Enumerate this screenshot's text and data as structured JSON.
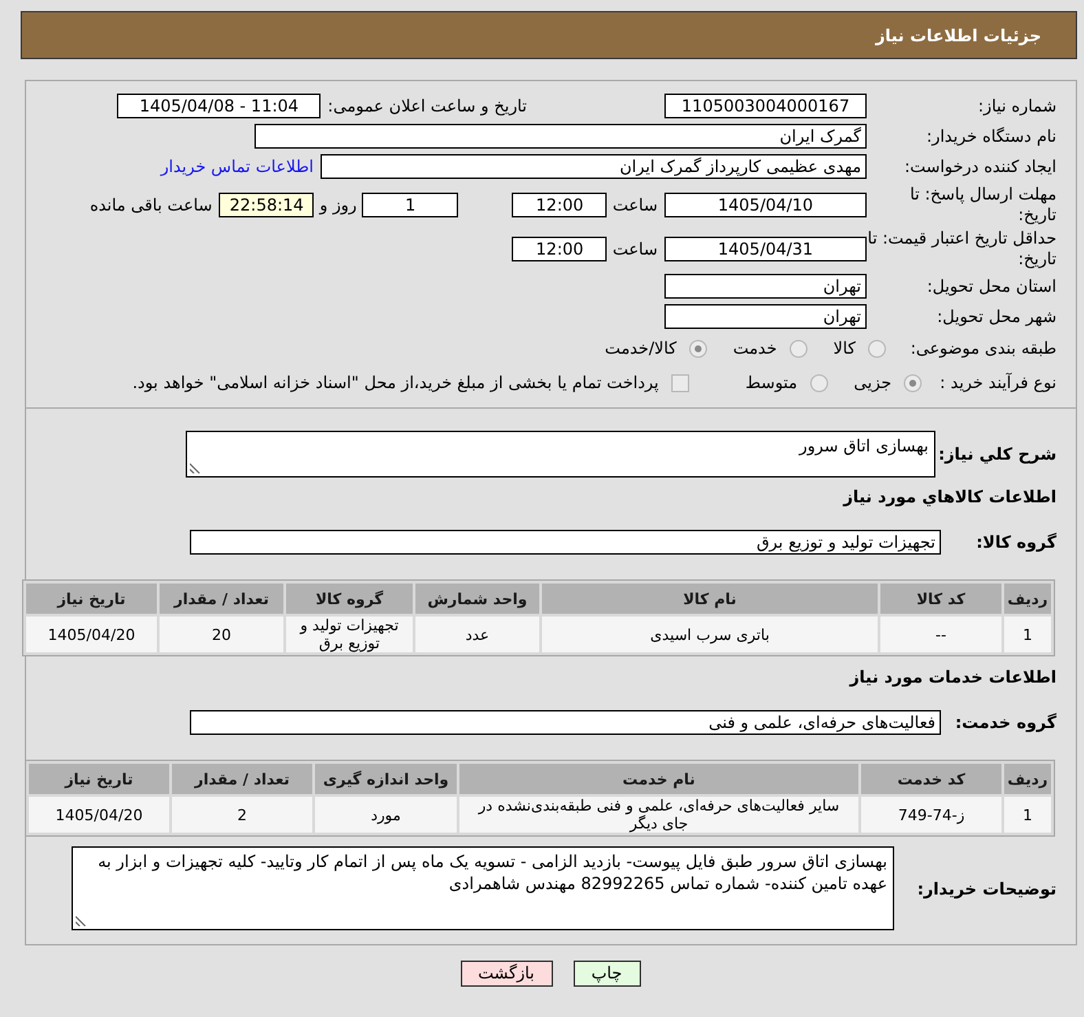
{
  "header": {
    "title": "جزئیات اطلاعات نیاز"
  },
  "need_info": {
    "need_number": {
      "label": "شماره نیاز:",
      "value": "1105003004000167"
    },
    "announcement": {
      "label": "تاریخ و ساعت اعلان عمومی:",
      "value": "1405/04/08 - 11:04"
    },
    "buyer_organization": {
      "label": "نام دستگاه خریدار:",
      "value": "گمرک ایران"
    },
    "requester": {
      "label": "ایجاد کننده درخواست:",
      "value": "مهدی عظیمی کارپرداز گمرک ایران",
      "contact_link": "اطلاعات تماس خریدار"
    },
    "response_deadline": {
      "label": "مهلت ارسال پاسخ: تا تاریخ:",
      "date": "1405/04/10",
      "time_label": "ساعت",
      "time": "12:00",
      "days": "1",
      "days_label": "روز و",
      "remaining_time": "22:58:14",
      "remaining_label": "ساعت باقی مانده"
    },
    "price_validity": {
      "label": "حداقل تاریخ اعتبار قیمت: تا تاریخ:",
      "date": "1405/04/31",
      "time_label": "ساعت",
      "time": "12:00"
    },
    "delivery_province": {
      "label": "استان محل تحویل:",
      "value": "تهران"
    },
    "delivery_city": {
      "label": "شهر محل تحویل:",
      "value": "تهران"
    },
    "subject_category": {
      "label": "طبقه بندی موضوعی:",
      "options": [
        {
          "label": "کالا",
          "selected": false
        },
        {
          "label": "خدمت",
          "selected": false
        },
        {
          "label": "کالا/خدمت",
          "selected": true
        }
      ]
    },
    "purchase_process": {
      "label": "نوع فرآیند خرید :",
      "options": [
        {
          "label": "جزیی",
          "selected": true
        },
        {
          "label": "متوسط",
          "selected": false
        }
      ],
      "treasury_payment": {
        "label": "پرداخت تمام یا بخشی از مبلغ خرید،از محل \"اسناد خزانه اسلامی\" خواهد بود.",
        "checked": false
      }
    }
  },
  "description": {
    "label": "شرح کلي نیاز:",
    "value": "بهسازی اتاق سرور"
  },
  "item_sections": [
    {
      "kind": "goods",
      "heading": "اطلاعات کالاهاي مورد نياز",
      "group_label": "گروه کالا:",
      "group_value": "تجهیزات تولید و توزیع برق",
      "table": {
        "columns": [
          "ردیف",
          "کد کالا",
          "نام کالا",
          "واحد شمارش",
          "گروه کالا",
          "تعداد / مقدار",
          "تاریخ نیاز"
        ],
        "rows": [
          [
            "1",
            "--",
            "باتری سرب اسیدی",
            "عدد",
            "تجهیزات تولید و توزیع برق",
            "20",
            "1405/04/20"
          ]
        ]
      }
    },
    {
      "kind": "services",
      "heading": "اطلاعات خدمات مورد نیاز",
      "group_label": "گروه خدمت:",
      "group_value": "فعالیت‌های حرفه‌ای، علمی و فنی",
      "table": {
        "columns": [
          "ردیف",
          "کد خدمت",
          "نام خدمت",
          "واحد اندازه گیری",
          "تعداد / مقدار",
          "تاریخ نیاز"
        ],
        "rows": [
          [
            "1",
            "ز-74-749",
            "سایر فعالیت‌های حرفه‌ای، علمی و فنی طبقه‌بندی‌نشده در جای دیگر",
            "مورد",
            "2",
            "1405/04/20"
          ]
        ]
      }
    }
  ],
  "buyer_notes": {
    "label": "توضیحات خریدار:",
    "value": "بهسازی اتاق سرور طبق فایل پیوست- بازدید الزامی - تسویه یک ماه پس از اتمام کار وتایید- کلیه تجهیزات و ابزار به عهده تامین کننده- شماره تماس 82992265 مهندس شاهمرادی"
  },
  "buttons": [
    {
      "label": "چاپ",
      "kind": "print"
    },
    {
      "label": "بازگشت",
      "kind": "back"
    }
  ]
}
